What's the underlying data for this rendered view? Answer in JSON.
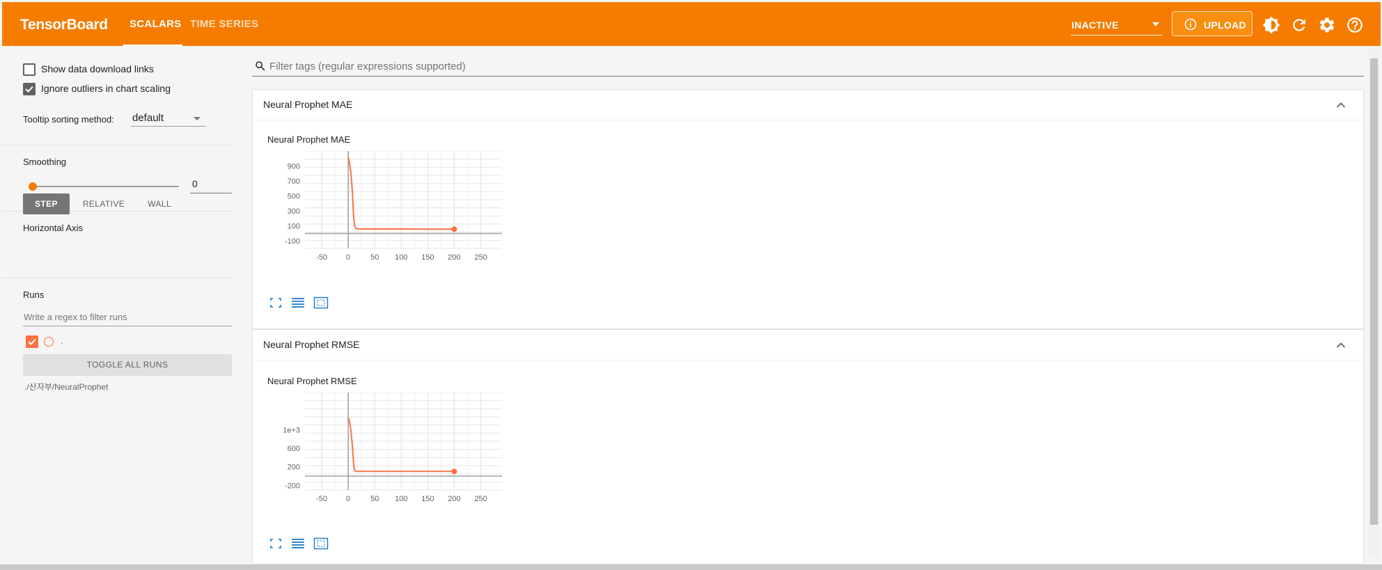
{
  "app": {
    "brand": "TensorBoard"
  },
  "tabs": [
    {
      "label": "SCALARS",
      "active": true
    },
    {
      "label": "TIME SERIES",
      "active": false
    }
  ],
  "toolbar": {
    "run_select_value": "INACTIVE",
    "upload_label": "UPLOAD",
    "icons": [
      "brightness-icon",
      "refresh-icon",
      "settings-icon",
      "help-icon"
    ]
  },
  "sidebar": {
    "show_download_links": {
      "label": "Show data download links",
      "checked": false
    },
    "ignore_outliers": {
      "label": "Ignore outliers in chart scaling",
      "checked": true
    },
    "tooltip_sorting": {
      "label": "Tooltip sorting method:",
      "value": "default"
    },
    "smoothing": {
      "label": "Smoothing",
      "value": "0",
      "slider_fraction": 0
    },
    "horizontal_axis": {
      "label": "Horizontal Axis",
      "options": [
        "STEP",
        "RELATIVE",
        "WALL"
      ],
      "selected": "STEP"
    },
    "runs": {
      "label": "Runs",
      "filter_placeholder": "Write a regex to filter runs",
      "run_name": ".",
      "toggle_all_label": "TOGGLE ALL RUNS",
      "run_path": "./산자부/NeuralProphet"
    }
  },
  "main": {
    "filter_placeholder": "Filter tags (regular expressions supported)",
    "run_color": "#ff7043"
  },
  "colors": {
    "primary": "#f57c00",
    "run": "#ff7043"
  },
  "chart_data": [
    {
      "type": "line",
      "title": "Neural Prophet MAE",
      "card_title": "Neural Prophet MAE",
      "xlim": [
        -75,
        290
      ],
      "ylim": [
        -200,
        1100
      ],
      "xticks": [
        "-50",
        "0",
        "50",
        "100",
        "150",
        "200",
        "250"
      ],
      "xtick_values": [
        -50,
        0,
        50,
        100,
        150,
        200,
        250
      ],
      "yticks": [
        "900",
        "700",
        "500",
        "300",
        "100",
        "-100"
      ],
      "ytick_values": [
        900,
        700,
        500,
        300,
        100,
        -100
      ],
      "series": [
        {
          "x": [
            0,
            2,
            5,
            8,
            10,
            12,
            15,
            20,
            30,
            50,
            100,
            150,
            200
          ],
          "y": [
            1020,
            960,
            820,
            550,
            250,
            100,
            65,
            60,
            60,
            60,
            60,
            58,
            58
          ]
        }
      ],
      "grid": true
    },
    {
      "type": "line",
      "title": "Neural Prophet RMSE",
      "card_title": "Neural Prophet RMSE",
      "xlim": [
        -75,
        290
      ],
      "ylim": [
        -300,
        1800
      ],
      "xticks": [
        "-50",
        "0",
        "50",
        "100",
        "150",
        "200",
        "250"
      ],
      "xtick_values": [
        -50,
        0,
        50,
        100,
        150,
        200,
        250
      ],
      "yticks": [
        "1e+3",
        "600",
        "200",
        "-200"
      ],
      "ytick_values": [
        1000,
        600,
        200,
        -200
      ],
      "series": [
        {
          "x": [
            0,
            2,
            5,
            8,
            10,
            12,
            15,
            20,
            30,
            50,
            100,
            150,
            200
          ],
          "y": [
            1260,
            1200,
            1000,
            650,
            300,
            120,
            100,
            100,
            100,
            100,
            100,
            100,
            100
          ]
        }
      ],
      "grid": true
    }
  ]
}
